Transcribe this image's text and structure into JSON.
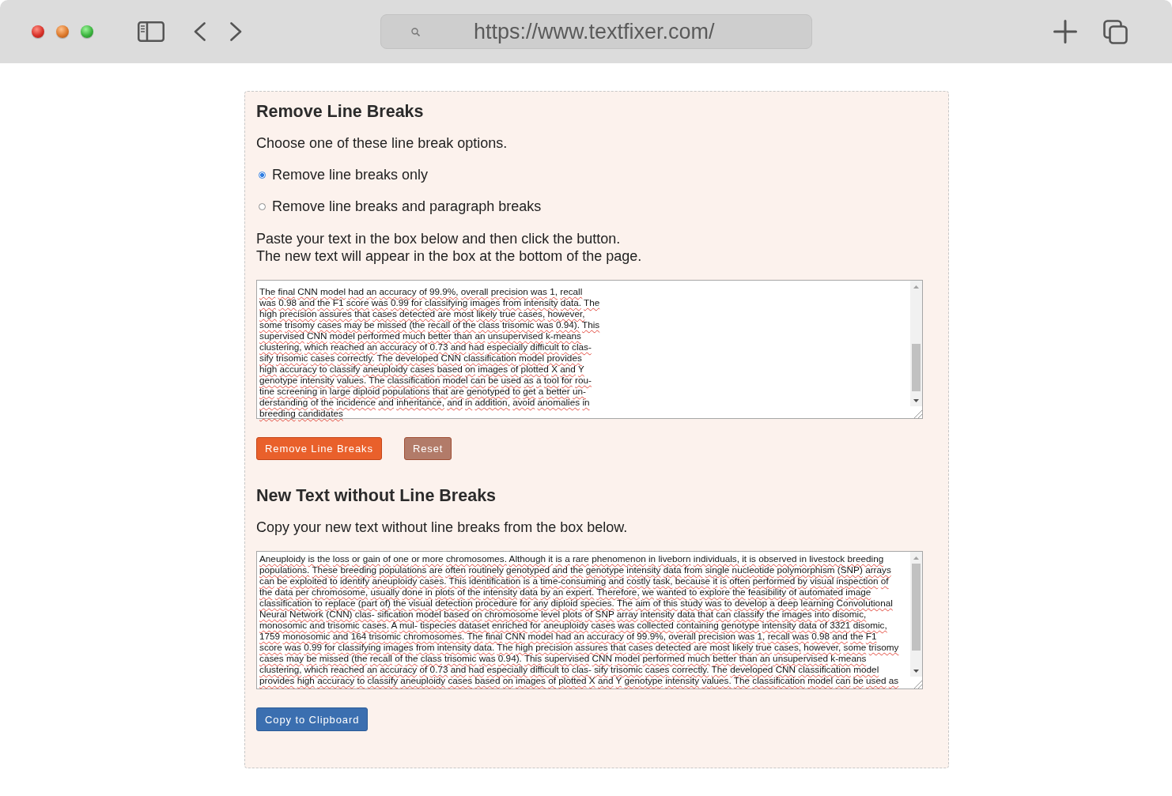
{
  "browser": {
    "url": "https://www.textfixer.com/"
  },
  "tool": {
    "title": "Remove Line Breaks",
    "intro": "Choose one of these line break options.",
    "options": [
      {
        "label": "Remove line breaks only",
        "selected": true
      },
      {
        "label": "Remove line breaks and paragraph breaks",
        "selected": false
      }
    ],
    "instructions": [
      "Paste your text in the box below and then click the button.",
      "The new text will appear in the box at the bottom of the page."
    ],
    "input_box": {
      "lines": [
        "The final CNN model had an accuracy of 99.9%, overall precision was 1, recall",
        "was 0.98 and the F1 score was 0.99 for classifying images from intensity data. The",
        "high precision assures that cases detected are most likely true cases, however,",
        "some trisomy cases may be missed (the recall of the class trisomic was 0.94). This",
        "supervised CNN model performed much better than an unsupervised k-means",
        "clustering, which reached an accuracy of 0.73 and had especially difficult to clas-",
        "sify trisomic cases correctly. The developed CNN classification model provides",
        "high accuracy to classify aneuploidy cases based on images of plotted X and Y",
        "genotype intensity values. The classification model can be used as a tool for rou-",
        "tine screening in large diploid populations that are genotyped to get a better un-",
        "derstanding of the incidence and inheritance, and in addition, avoid anomalies in",
        "breeding candidates"
      ]
    },
    "buttons": [
      {
        "label": "Remove Line Breaks",
        "kind": "primary"
      },
      {
        "label": "Reset",
        "kind": "secondary"
      }
    ]
  },
  "result": {
    "title": "New Text without Line Breaks",
    "intro": "Copy your new text without line breaks from the box below.",
    "output_box": {
      "lines": [
        "Aneuploidy is the loss or gain of one or more chromosomes. Although it is a rare phenomenon in liveborn individuals, it is observed in livestock breeding",
        "populations. These breeding populations are often routinely genotyped and the genotype intensity data from single nucleotide polymorphism (SNP) arrays",
        "can be exploited to identify aneuploidy cases. This identification is a time-consuming and costly task, because it is often performed by visual inspection of",
        "the data per chromosome, usually done in plots of the intensity data by an expert. Therefore, we wanted to explore the feasibility of automated image",
        "classification to replace (part of) the visual detection procedure for any diploid species. The aim of this study was to develop a deep learning Convolutional",
        "Neural Network (CNN) clas- sification model based on chromosome level plots of SNP array intensity data that can classify the images into disomic,",
        "monosomic and trisomic cases. A mul- tispecies dataset enriched for aneuploidy cases was collected containing genotype intensity data of 3321 disomic,",
        "1759 monosomic and 164 trisomic chromosomes. The final CNN model had an accuracy of 99.9%, overall precision was 1, recall was 0.98 and the F1",
        "score was 0.99 for classifying images from intensity data. The high precision assures that cases detected are most likely true cases, however, some trisomy",
        "cases may be missed (the recall of the class trisomic was 0.94). This supervised CNN model performed much better than an unsupervised k-means",
        "clustering, which reached an accuracy of 0.73 and had especially difficult to clas- sify trisomic cases correctly. The developed CNN classification model",
        "provides high accuracy to classify aneuploidy cases based on images of plotted X and Y genotype intensity values. The classification model can be used as"
      ]
    },
    "buttons": [
      {
        "label": "Copy to Clipboard",
        "kind": "info"
      }
    ]
  }
}
